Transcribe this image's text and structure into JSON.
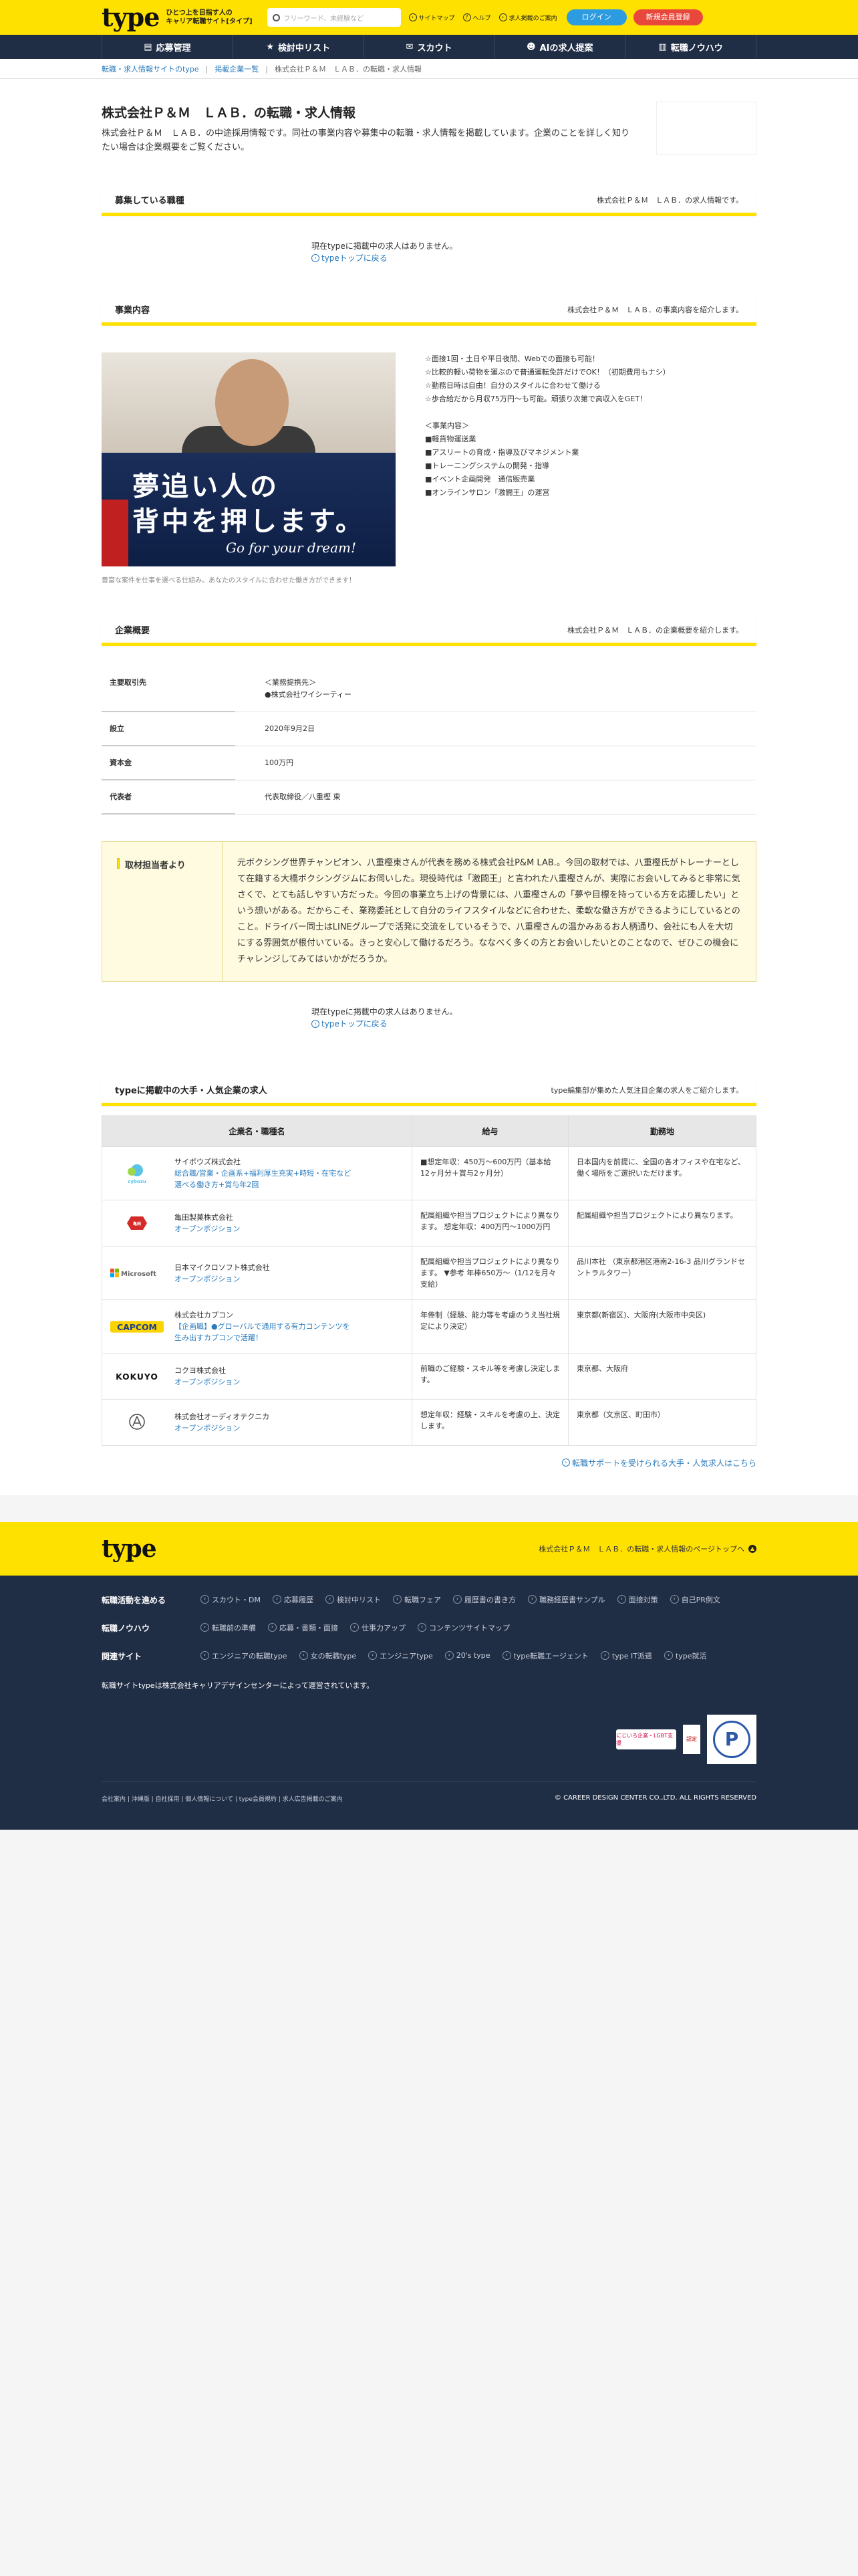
{
  "header": {
    "logo": "type",
    "tagline_1": "ひとつ上を目指す人の",
    "tagline_2": "キャリア転職サイト[タイプ]",
    "search_placeholder": "フリーワード、未経験など",
    "links": [
      "サイトマップ",
      "ヘルプ",
      "求人掲載のご案内"
    ],
    "login": "ログイン",
    "register": "新規会員登録"
  },
  "nav": {
    "items": [
      "応募管理",
      "検討中リスト",
      "スカウト",
      "AIの求人提案",
      "転職ノウハウ"
    ],
    "icons": [
      "clipboard-icon",
      "star-icon",
      "mail-icon",
      "ai-icon",
      "book-icon"
    ]
  },
  "breadcrumb": [
    "転職・求人情報サイトのtype",
    "掲載企業一覧",
    "株式会社Ｐ＆Ｍ　ＬＡＢ．の転職・求人情報"
  ],
  "page": {
    "title": "株式会社Ｐ＆Ｍ　ＬＡＢ．の転職・求人情報",
    "intro": "株式会社Ｐ＆Ｍ　ＬＡＢ．の中途採用情報です。同社の事業内容や募集中の転職・求人情報を掲載しています。企業のことを詳しく知りたい場合は企業概要をご覧ください。"
  },
  "jobs_section": {
    "title": "募集している職種",
    "sub": "株式会社Ｐ＆Ｍ　ＬＡＢ．の求人情報です。",
    "none": "現在typeに掲載中の求人はありません。",
    "back": "typeトップに戻る"
  },
  "business": {
    "title": "事業内容",
    "sub": "株式会社Ｐ＆Ｍ　ＬＡＢ．の事業内容を紹介します。",
    "image_line1": "夢追い人の",
    "image_line2": "背中を押します。",
    "image_line3": "Go for your dream!",
    "caption": "豊富な案件を仕事を選べる仕組み。あなたのスタイルに合わせた働き方ができます！",
    "text": "☆面接1回・土日や平日夜間、Webでの面接も可能！\n☆比較的軽い荷物を運ぶので普通運転免許だけでOK！（初期費用もナシ）\n☆勤務日時は自由！自分のスタイルに合わせて働ける\n☆歩合給だから月収75万円〜も可能。頑張り次第で高収入をGET！\n\n＜事業内容＞\n■軽貨物運送業\n■アスリートの育成・指導及びマネジメント業\n■トレーニングシステムの開発・指導\n■イベント企画開発　通信販売業\n■オンラインサロン「激闘王」の運営"
  },
  "overview": {
    "title": "企業概要",
    "sub": "株式会社Ｐ＆Ｍ　ＬＡＢ．の企業概要を紹介します。",
    "rows": [
      {
        "k": "主要取引先",
        "v": "＜業務提携先＞\n●株式会社ワイシーティー"
      },
      {
        "k": "設立",
        "v": "2020年9月2日"
      },
      {
        "k": "資本金",
        "v": "100万円"
      },
      {
        "k": "代表者",
        "v": "代表取締役／八重樫 東"
      }
    ]
  },
  "interview": {
    "label": "取材担当者より",
    "body": "元ボクシング世界チャンピオン、八重樫東さんが代表を務める株式会社P&M LAB.。今回の取材では、八重樫氏がトレーナーとして在籍する大橋ボクシングジムにお伺いした。現役時代は「激闘王」と言われた八重樫さんが、実際にお会いしてみると非常に気さくで、とても話しやすい方だった。今回の事業立ち上げの背景には、八重樫さんの「夢や目標を持っている方を応援したい」という想いがある。だからこそ、業務委託として自分のライフスタイルなどに合わせた、柔軟な働き方ができるようにしているとのこと。ドライバー同士はLINEグループで活発に交流をしているそうで、八重樫さんの温かみあるお人柄通り、会社にも人を大切にする雰囲気が根付いている。きっと安心して働けるだろう。ななべく多くの方とお会いしたいとのことなので、ぜひこの機会にチャレンジしてみてはいかがだろうか。"
  },
  "jobs_section2": {
    "none": "現在typeに掲載中の求人はありません。",
    "back": "typeトップに戻る"
  },
  "popular": {
    "title": "typeに掲載中の大手・人気企業の求人",
    "sub": "type編集部が集めた人気注目企業の求人をご紹介します。",
    "headers": [
      "企業名・職種名",
      "給与",
      "勤務地"
    ],
    "rows": [
      {
        "logo": "cybozu",
        "name": "サイボウズ株式会社",
        "job": "総合職/営業・企画系+福利厚生充実+時短・在宅など\n選べる働き方+賞与年2回",
        "salary": "■想定年収：450万〜600万円（基本給12ヶ月分＋賞与2ヶ月分）",
        "place": "日本国内を前提に、全国の各オフィスや在宅など、働く場所をご選択いただけます。"
      },
      {
        "logo": "KAMEDA",
        "name": "亀田製菓株式会社",
        "job": "オープンポジション",
        "salary": "配属組織や担当プロジェクトにより異なります。\n想定年収：400万円〜1000万円",
        "place": "配属組織や担当プロジェクトにより異なります。"
      },
      {
        "logo": "Microsoft",
        "name": "日本マイクロソフト株式会社",
        "job": "オープンポジション",
        "salary": "配属組織や担当プロジェクトにより異なります。\n▼参考 年棒650万〜（1/12を月々支給）",
        "place": "品川本社\n（東京都港区港南2-16-3 品川グランドセントラルタワー）"
      },
      {
        "logo": "CAPCOM",
        "name": "株式会社カプコン",
        "job": "【企画職】●グローバルで通用する有力コンテンツを\n生み出すカプコンで活躍！",
        "salary": "年俸制（経験、能力等を考慮のうえ当社規定により決定）",
        "place": "東京都(新宿区)、大阪府(大阪市中央区)"
      },
      {
        "logo": "KOKUYO",
        "name": "コクヨ株式会社",
        "job": "オープンポジション",
        "salary": "前職のご経験・スキル等を考慮し決定します。",
        "place": "東京都、大阪府"
      },
      {
        "logo": "audio-technica",
        "name": "株式会社オーディオテクニカ",
        "job": "オープンポジション",
        "salary": "想定年収：経験・スキルを考慮の上、決定します。",
        "place": "東京都（文京区、町田市）"
      }
    ],
    "more": "転職サポートを受けられる大手・人気求人はこちら"
  },
  "footband": {
    "logo": "type",
    "link": "株式会社Ｐ＆Ｍ　ＬＡＢ．の転職・求人情報のページトップへ"
  },
  "footer": {
    "rows": [
      {
        "h": "転職活動を進める",
        "items": [
          "スカウト・DM",
          "応募履歴",
          "検討中リスト",
          "転職フェア",
          "履歴書の書き方",
          "職務経歴書サンプル",
          "面接対策",
          "自己PR例文"
        ]
      },
      {
        "h": "転職ノウハウ",
        "items": [
          "転職前の準備",
          "応募・書類・面接",
          "仕事力アップ",
          "コンテンツサイトマップ"
        ]
      },
      {
        "h": "関連サイト",
        "items": [
          "エンジニアの転職type",
          "女の転職type",
          "エンジニアtype",
          "20's type",
          "type転職エージェント",
          "type IT派遣",
          "type就活"
        ]
      }
    ],
    "note": "転職サイトtypeは株式会社キャリアデザインセンターによって運営されています。",
    "bottom_links": "会社案内 | 沖縄版 | 自社採用 | 個人情報について | type会員規約 | 求人広告掲載のご案内",
    "copyright": "© CAREER DESIGN CENTER CO.,LTD. ALL RIGHTS RESERVED",
    "badge1": "にじいろ企業・LGBT支援",
    "badge2": "認定",
    "badge3": "P"
  },
  "colors": {
    "accent": "#ffe100",
    "navy": "#1f2d45",
    "link": "#2a7bbd",
    "login": "#2c9be0",
    "register": "#e8483c"
  }
}
